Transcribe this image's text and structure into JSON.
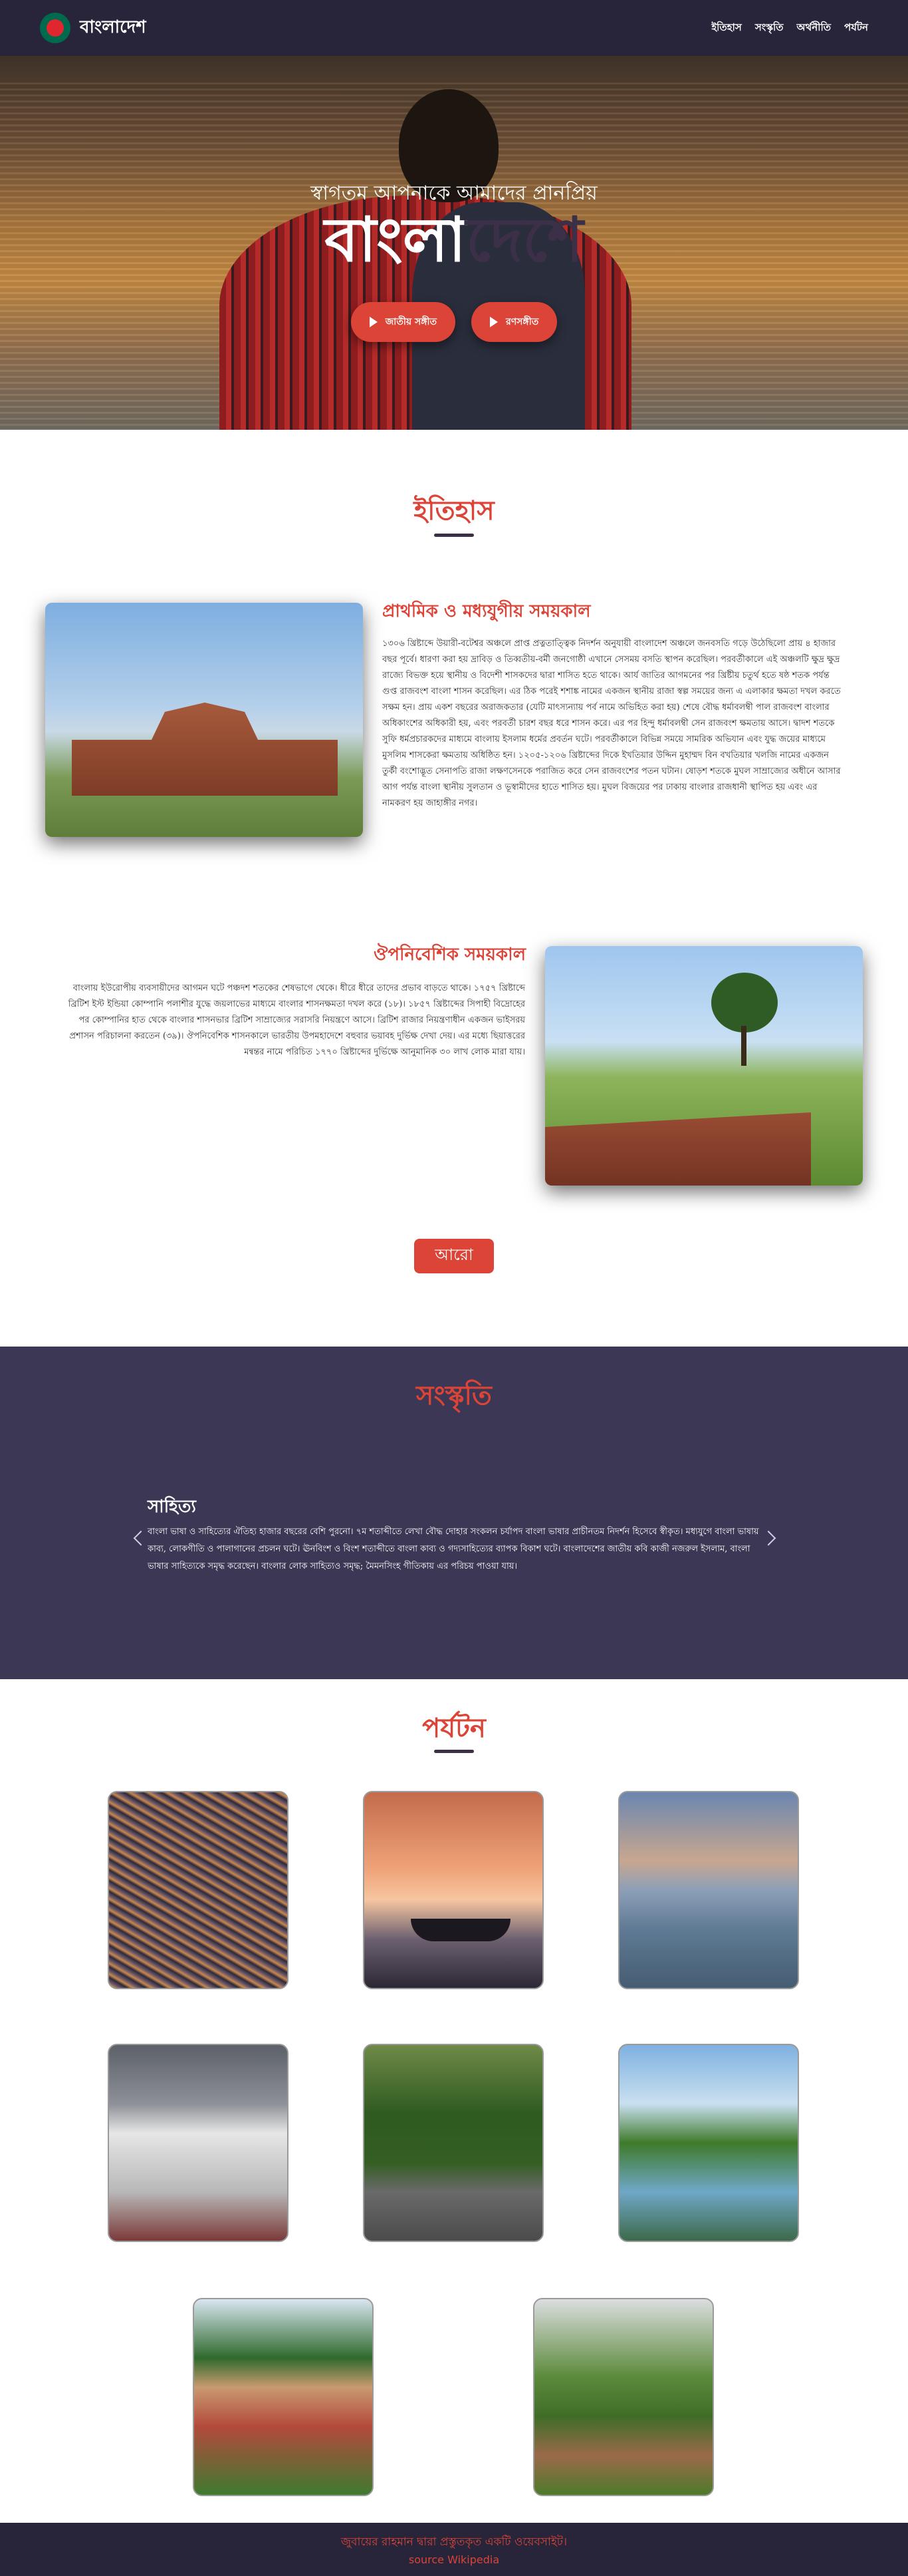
{
  "nav": {
    "brand": "বাংলাদেশ",
    "links": [
      "ইতিহাস",
      "সংস্কৃতি",
      "অর্থনীতি",
      "পর্যটন"
    ]
  },
  "hero": {
    "subtitle": "স্বাগতম আপনাকে আমাদের প্রানপ্রিয়",
    "title_part1": "বাংলা",
    "title_part2": "দেশে",
    "buttons": [
      "জাতীয় সঙ্গীত",
      "রণসঙ্গীত"
    ]
  },
  "history": {
    "title": "ইতিহাস",
    "block1_heading": "প্রাথমিক ও মধ্যযুগীয় সময়কাল",
    "block1_text": "১৩০৬ খ্রিষ্টাব্দে উয়ারী-বটেশ্বর অঞ্চলে প্রাপ্ত প্রত্নতাত্ত্বিক নিদর্শন অনুযায়ী বাংলাদেশ অঞ্চলে জনবসতি গড়ে উঠেছিলো প্রায় ৪ হাজার বছর পূর্বে। ধারণা করা হয় দ্রাবিড় ও তিব্বতীয়-বর্মী জনগোষ্ঠী এখানে সেসময় বসতি স্থাপন করেছিল। পরবর্তীকালে এই অঞ্চলটি ক্ষুদ্র ক্ষুদ্র রাজ্যে বিভক্ত হয়ে স্থানীয় ও বিদেশী শাসকদের দ্বারা শাসিত হতে থাকে। আর্য জাতির আগমনের পর খ্রিষ্টীয় চতুর্থ হতে ষষ্ঠ শতক পর্যন্ত গুপ্ত রাজবংশ বাংলা শাসন করেছিল। এর ঠিক পরেই শশাঙ্ক নামের একজন স্থানীয় রাজা স্বল্প সময়ের জন্য এ এলাকার ক্ষমতা দখল করতে সক্ষম হন। প্রায় একশ বছরের অরাজকতার (যেটি মাৎস্যন্যায় পর্ব নামে অভিহিত করা হয়) শেষে বৌদ্ধ ধর্মাবলম্বী পাল রাজবংশ বাংলার অধিকাংশের অধিকারী হয়, এবং পরবর্তী চারশ বছর ধরে শাসন করে। এর পর হিন্দু ধর্মাবলম্বী সেন রাজবংশ ক্ষমতায় আসে। দ্বাদশ শতকে সুফি ধর্মপ্রচারকদের মাধ্যমে বাংলায় ইসলাম ধর্মের প্রবর্তন ঘটে। পরবর্তীকালে বিভিন্ন সময়ে সামরিক অভিযান এবং যুদ্ধ জয়ের মাধ্যমে মুসলিম শাসকেরা ক্ষমতায় অধিষ্ঠিত হন। ১২০৫-১২০৬ খ্রিষ্টাব্দের দিকে ইখতিয়ার উদ্দিন মুহাম্মদ বিন বখতিয়ার খলজি নামের একজন তুর্কী বংশোদ্ভূত সেনাপতি রাজা লক্ষণসেনকে পরাজিত করে সেন রাজবংশের পতন ঘটান। ষোড়শ শতকে মুঘল সাম্রাজ্যের অধীনে আসার আগ পর্যন্ত বাংলা স্থানীয় সুলতান ও ভূস্বামীদের হাতে শাসিত হয়। মুঘল বিজয়ের পর ঢাকায় বাংলার রাজধানী স্থাপিত হয় এবং এর নামকরণ হয় জাহাঙ্গীর নগর।",
    "block2_heading": "ঔপনিবেশিক সময়কাল",
    "block2_text": "বাংলায় ইউরোপীয় ব্যবসায়ীদের আগমন ঘটে পঞ্চদশ শতকের শেষভাগে থেকে। ধীরে ধীরে তাদের প্রভাব বাড়তে থাকে। ১৭৫৭ খ্রিষ্টাব্দে ব্রিটিশ ইস্ট ইন্ডিয়া কোম্পানি পলাশীর যুদ্ধে জয়লাভের মাধ্যমে বাংলার শাসনক্ষমতা দখল করে (১৮)। ১৮৫৭ খ্রিষ্টাব্দের সিপাহী বিদ্রোহের পর কোম্পানির হাত থেকে বাংলার শাসনভার ব্রিটিশ সাম্রাজ্যের সরাসরি নিয়ন্ত্রণে আসে। ব্রিটিশ রাজার নিয়ন্ত্রণাধীন একজন ভাইসরয় প্রশাসন পরিচালনা করতেন (৩৯)। ঔপনিবেশিক শাসনকালে ভারতীয় উপমহাদেশে বহুবার ভয়াবহ দুর্ভিক্ষ দেখা দেয়। এর মধ্যে ছিয়াত্তরের মন্বন্তর নামে পরিচিত ১৭৭০ খ্রিষ্টাব্দের দুর্ভিক্ষে আনুমানিক ৩০ লাখ লোক মারা যায়।",
    "more_button": "আরো"
  },
  "culture": {
    "title": "সংস্কৃতি",
    "heading": "সাহিত্য",
    "text": "বাংলা ভাষা ও সাহিত্যের ঐতিহ্য হাজার বছরের বেশি পুরনো। ৭ম শতাব্দীতে লেখা বৌদ্ধ দোহার সংকলন চর্যাপদ বাংলা ভাষার প্রাচীনতম নিদর্শন হিসেবে স্বীকৃত। মধ্যযুগে বাংলা ভাষায় কাব্য, লোকগীতি ও পালাগানের প্রচলন ঘটে। ঊনবিংশ ও বিংশ শতাব্দীতে বাংলা কাব্য ও গদ্যসাহিত্যের ব্যাপক বিকাশ ঘটে। বাংলাদেশের জাতীয় কবি কাজী নজরুল ইসলাম, বাংলা ভাষার সাহিত্যকে সমৃদ্ধ করেছেন। বাংলার লোক সাহিত্যও সমৃদ্ধ; মৈমনসিংহ গীতিকায় এর পরিচয় পাওয়া যায়।"
  },
  "tourism": {
    "title": "পর্যটন",
    "cards": [
      "city-aerial",
      "sunset-boat",
      "river-launch",
      "palace-building",
      "tree-lined-road",
      "lake-forest",
      "historic-mansion",
      "tea-garden"
    ]
  },
  "footer": {
    "line1": "জুবায়ের রাহমান দ্বারা প্রস্তুতকৃত একটি ওয়েবসাইট।",
    "line2": "source Wikipedia"
  }
}
